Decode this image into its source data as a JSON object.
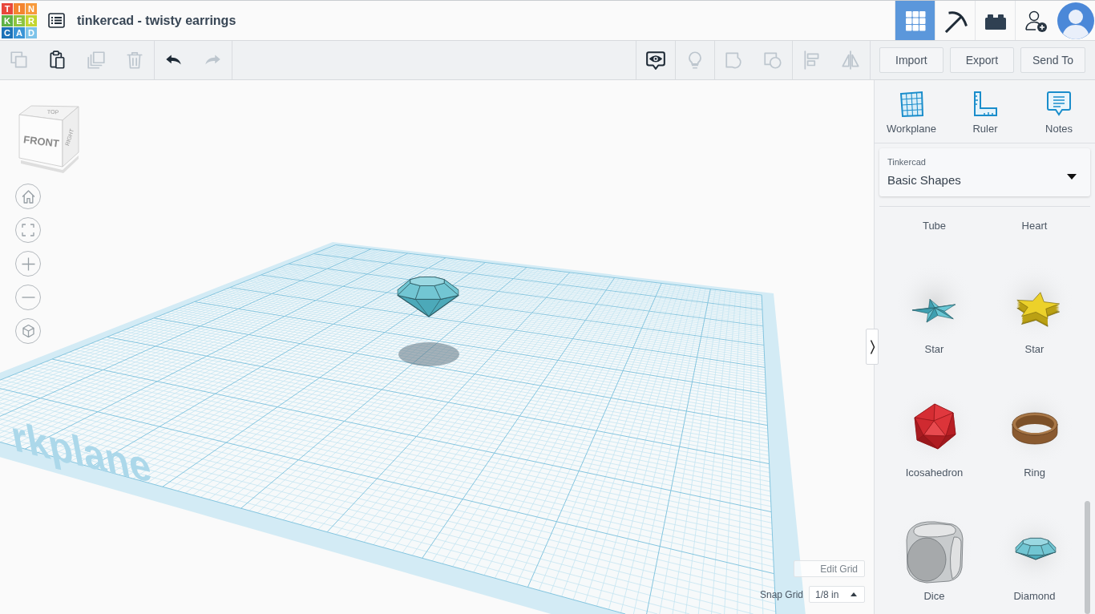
{
  "header": {
    "logo": [
      {
        "letter": "T",
        "color": "#e8473b"
      },
      {
        "letter": "I",
        "color": "#f38530"
      },
      {
        "letter": "N",
        "color": "#f79a3c"
      },
      {
        "letter": "K",
        "color": "#5fb246"
      },
      {
        "letter": "E",
        "color": "#8cc43f"
      },
      {
        "letter": "R",
        "color": "#c4d52f"
      },
      {
        "letter": "C",
        "color": "#1b72b8"
      },
      {
        "letter": "A",
        "color": "#3a95d6"
      },
      {
        "letter": "D",
        "color": "#7cc3e9"
      }
    ],
    "title": "tinkercad - twisty earrings",
    "view_modes": [
      {
        "kind": "grid",
        "selected": true
      },
      {
        "kind": "pickaxe",
        "selected": false
      },
      {
        "kind": "bricks",
        "selected": false
      }
    ]
  },
  "toolbar": {
    "left_groups": [
      [
        {
          "kind": "copy",
          "disabled": true
        },
        {
          "kind": "paste",
          "disabled": false
        },
        {
          "kind": "duplicate",
          "disabled": true
        },
        {
          "kind": "delete",
          "disabled": true
        }
      ],
      [
        {
          "kind": "undo",
          "disabled": false
        },
        {
          "kind": "redo",
          "disabled": true
        }
      ]
    ],
    "right_groups": [
      [
        {
          "kind": "notes_toggle",
          "disabled": false
        }
      ],
      [
        {
          "kind": "light",
          "disabled": true
        }
      ],
      [
        {
          "kind": "group",
          "disabled": true
        },
        {
          "kind": "hole",
          "disabled": true
        }
      ],
      [
        {
          "kind": "align",
          "disabled": true
        },
        {
          "kind": "mirror",
          "disabled": true
        }
      ]
    ],
    "buttons": [
      "Import",
      "Export",
      "Send To"
    ]
  },
  "viewport": {
    "view_cube": {
      "front": "FRONT",
      "top": "TOP",
      "right": "RIGHT"
    },
    "nav_buttons": [
      {
        "kind": "home"
      },
      {
        "kind": "fit"
      },
      {
        "kind": "zoom_in"
      },
      {
        "kind": "zoom_out"
      },
      {
        "kind": "ortho"
      }
    ],
    "workplane_label": "rkplane",
    "edit_grid": "Edit Grid",
    "snap_grid": {
      "label": "Snap Grid",
      "value": "1/8 in"
    }
  },
  "panel": {
    "tools": [
      {
        "kind": "workplane",
        "label": "Workplane"
      },
      {
        "kind": "ruler",
        "label": "Ruler"
      },
      {
        "kind": "notes",
        "label": "Notes"
      }
    ],
    "library": {
      "source": "Tinkercad",
      "value": "Basic Shapes"
    },
    "shapes": [
      {
        "kind": "tube",
        "label": "Tube"
      },
      {
        "kind": "heart",
        "label": "Heart"
      },
      {
        "kind": "star_flat",
        "label": "Star"
      },
      {
        "kind": "star",
        "label": "Star"
      },
      {
        "kind": "icosahedron",
        "label": "Icosahedron"
      },
      {
        "kind": "ring",
        "label": "Ring"
      },
      {
        "kind": "dice",
        "label": "Dice"
      },
      {
        "kind": "diamond",
        "label": "Diamond"
      }
    ]
  }
}
